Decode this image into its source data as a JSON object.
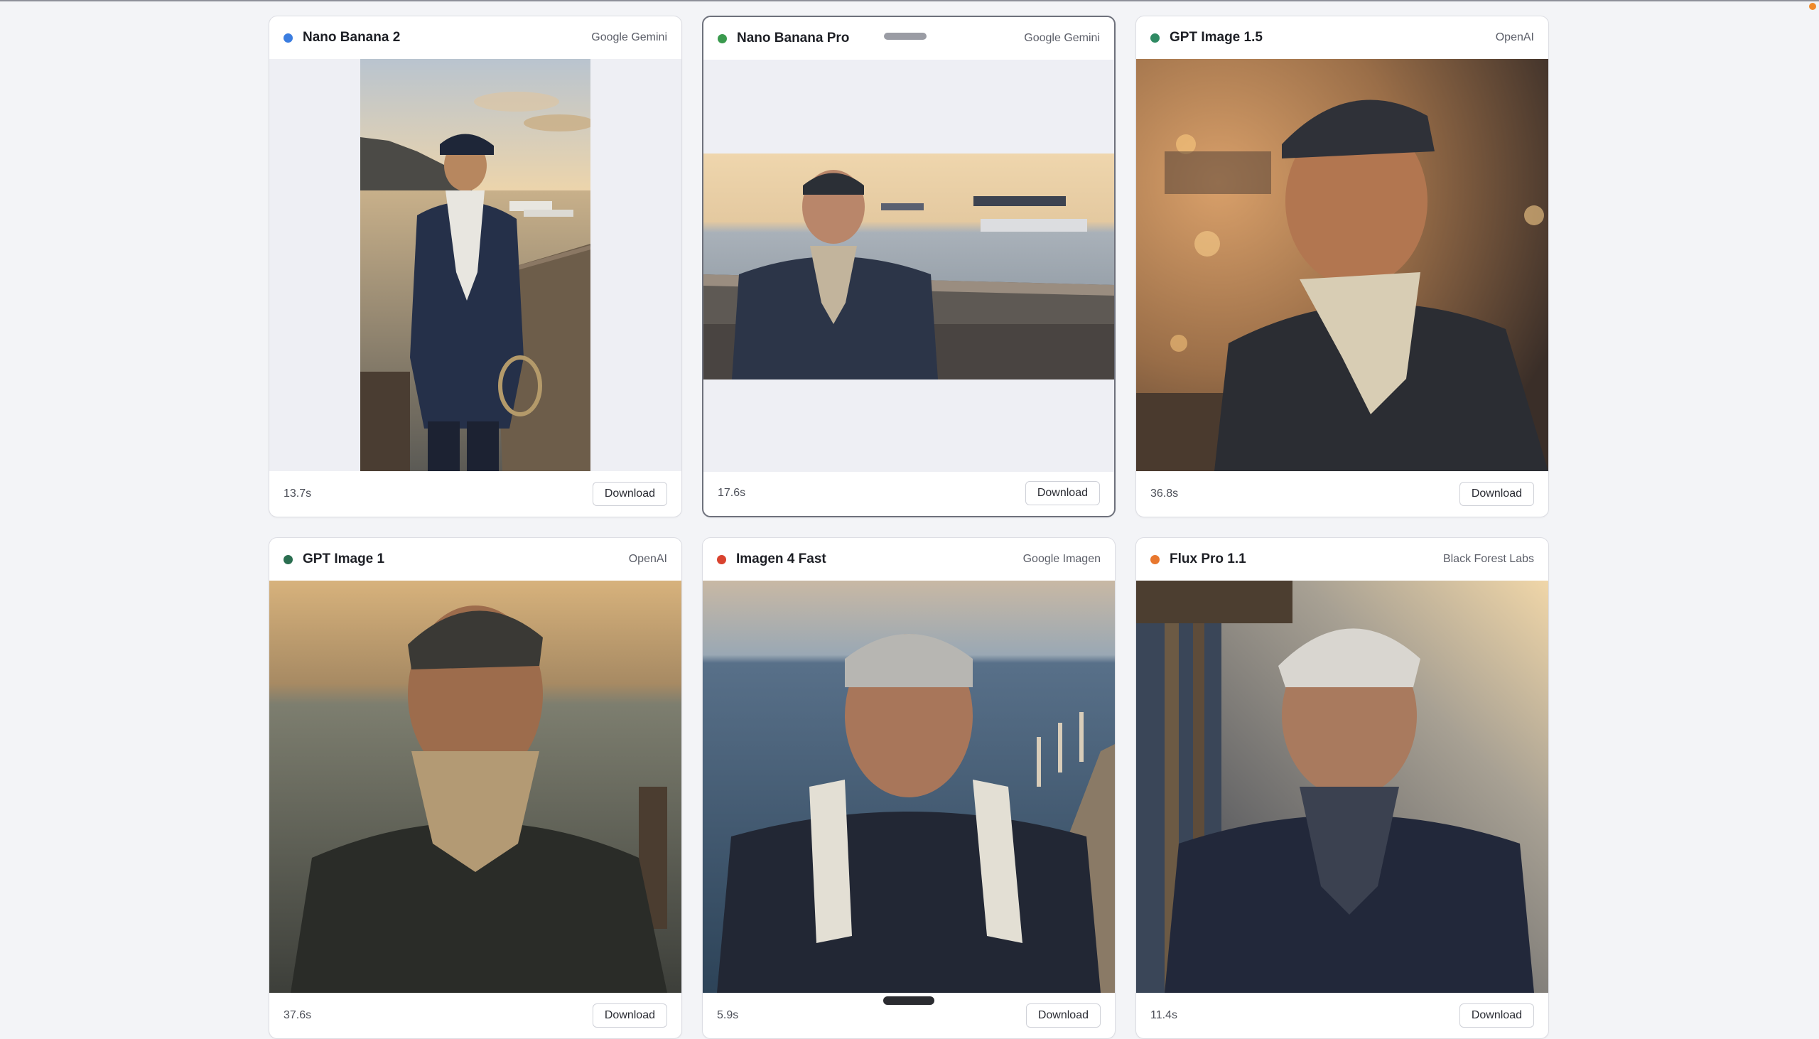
{
  "cards": [
    {
      "model": "Nano Banana 2",
      "provider": "Google Gemini",
      "time": "13.7s",
      "download_label": "Download",
      "dot_color": "#3b7de0",
      "photo_alt": "Elderly fisherman standing on a wooden pier holding a rope at sunset"
    },
    {
      "model": "Nano Banana Pro",
      "provider": "Google Gemini",
      "time": "17.6s",
      "download_label": "Download",
      "dot_color": "#3a9a4e",
      "photo_alt": "Elderly man in navy jacket on a pier with boats behind him"
    },
    {
      "model": "GPT Image 1.5",
      "provider": "OpenAI",
      "time": "36.8s",
      "download_label": "Download",
      "dot_color": "#2f8a63",
      "photo_alt": "Close portrait of an elderly fisherman in a cap and towel scarf at golden hour"
    },
    {
      "model": "GPT Image 1",
      "provider": "OpenAI",
      "time": "37.6s",
      "download_label": "Download",
      "dot_color": "#2a6e50",
      "photo_alt": "Elderly man with knit scarf at sunset by the sea"
    },
    {
      "model": "Imagen 4 Fast",
      "provider": "Google Imagen",
      "time": "5.9s",
      "download_label": "Download",
      "dot_color": "#d9432f",
      "photo_alt": "Elderly man with white towel on a pier over blue sea"
    },
    {
      "model": "Flux Pro 1.1",
      "provider": "Black Forest Labs",
      "time": "11.4s",
      "download_label": "Download",
      "dot_color": "#e8772e",
      "photo_alt": "Elderly man with grey hair and scarf beside a wooden dock"
    }
  ]
}
